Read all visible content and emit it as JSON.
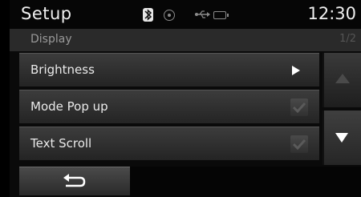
{
  "status_bar": {
    "title": "Setup",
    "time": "12:30",
    "icons": [
      "bluetooth-icon",
      "disc-icon",
      "usb-icon",
      "battery-icon"
    ]
  },
  "subheader": {
    "section": "Display",
    "page": "1/2"
  },
  "list": {
    "items": [
      {
        "label": "Brightness",
        "control": "arrow-right-icon"
      },
      {
        "label": "Mode Pop up",
        "control": "checkbox",
        "checked": true
      },
      {
        "label": "Text Scroll",
        "control": "checkbox",
        "checked": true
      }
    ]
  },
  "scroll": {
    "up_icon": "triangle-up-icon",
    "down_icon": "triangle-down-icon",
    "up_enabled": false
  },
  "back": {
    "icon": "back-arrow-icon"
  },
  "colors": {
    "background": "#0a0a0a",
    "row": "#2e2e2e",
    "text": "#eaeaea",
    "muted": "#9a9a9a"
  }
}
